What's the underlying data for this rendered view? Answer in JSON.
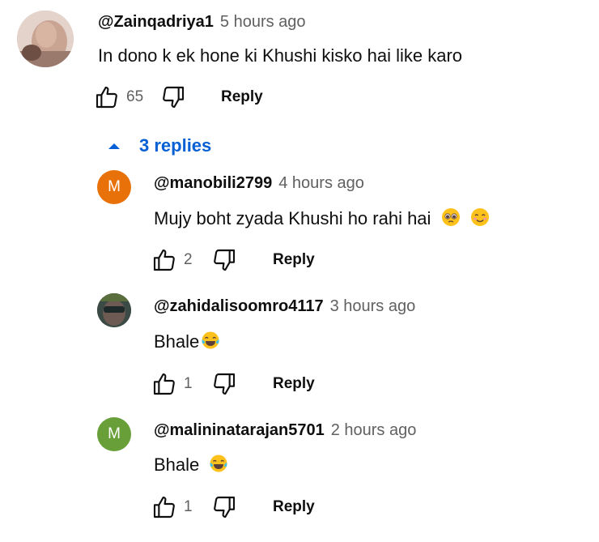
{
  "top_comment": {
    "author": "@Zainqadriya1",
    "time": "5 hours ago",
    "text": "In dono k ek hone ki Khushi kisko hai like karo",
    "likes": "65",
    "reply_label": "Reply"
  },
  "replies_toggle": {
    "label": "3 replies"
  },
  "replies": [
    {
      "author": "@manobili2799",
      "time": "4 hours ago",
      "avatar_letter": "M",
      "avatar_color": "#e8710a",
      "text": "Mujy boht zyada Khushi  ho rahi hai",
      "likes": "2",
      "reply_label": "Reply"
    },
    {
      "author": "@zahidalisoomro4117",
      "time": "3 hours ago",
      "text": "Bhale",
      "likes": "1",
      "reply_label": "Reply"
    },
    {
      "author": "@malininatarajan5701",
      "time": "2 hours ago",
      "avatar_letter": "M",
      "avatar_color": "#689f38",
      "text": "Bhale",
      "likes": "1",
      "reply_label": "Reply"
    }
  ]
}
